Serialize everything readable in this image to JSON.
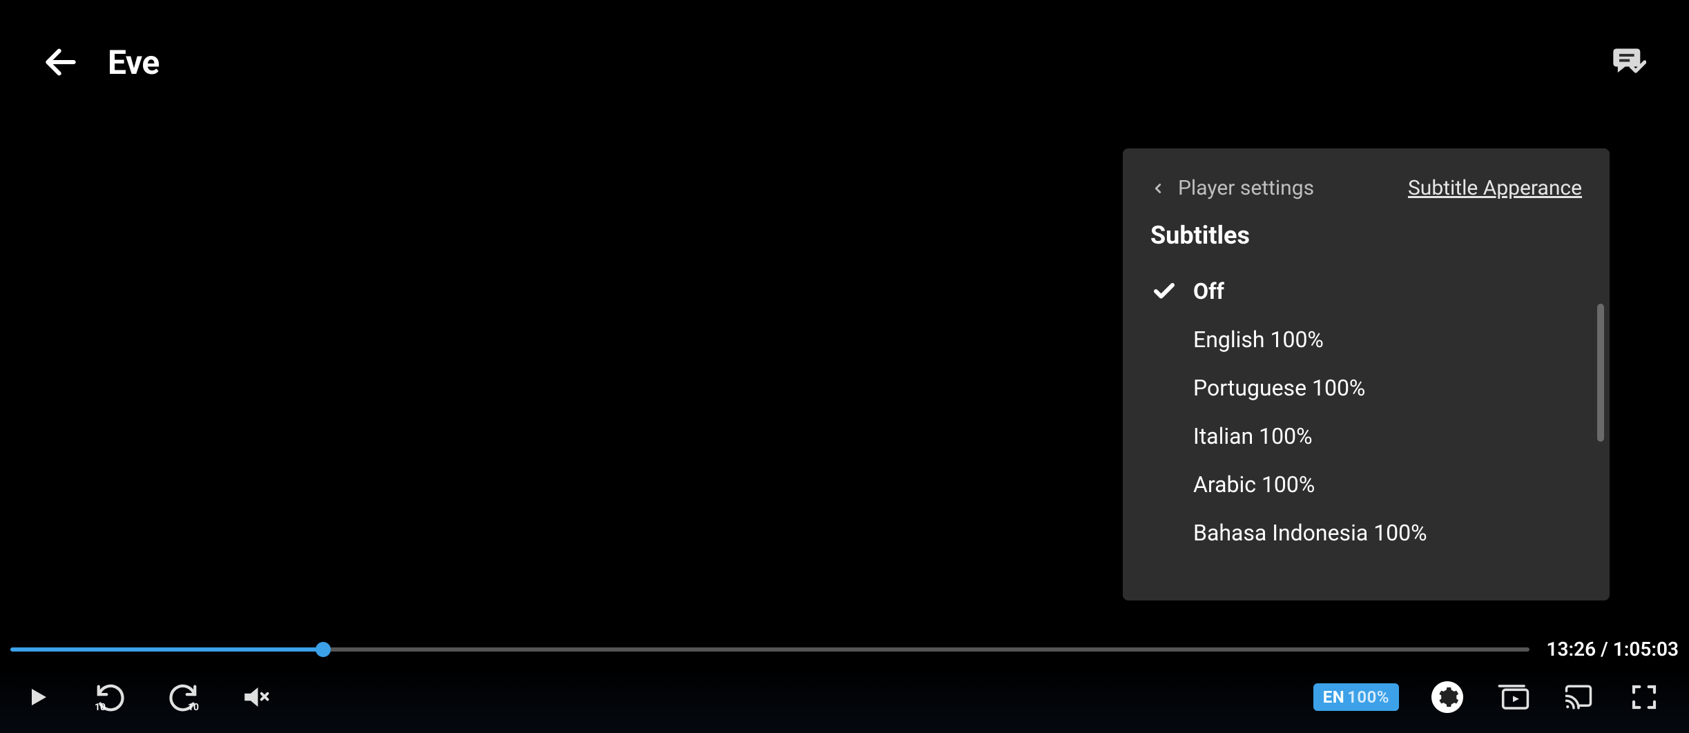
{
  "header": {
    "title": "Eve"
  },
  "popup": {
    "back_label": "Player settings",
    "appearance_link": "Subtitle Apperance",
    "section_title": "Subtitles",
    "options": [
      {
        "label": "Off",
        "selected": true
      },
      {
        "label": "English   100%",
        "selected": false
      },
      {
        "label": "Portuguese   100%",
        "selected": false
      },
      {
        "label": "Italian   100%",
        "selected": false
      },
      {
        "label": "Arabic   100%",
        "selected": false
      },
      {
        "label": "Bahasa Indonesia   100%",
        "selected": false
      }
    ]
  },
  "progress": {
    "current": "13:26",
    "total": "1:05:03",
    "percent": 20.6
  },
  "controls": {
    "cc_lang": "EN",
    "cc_percent": "100%",
    "seek_seconds": "10"
  },
  "colors": {
    "accent": "#3ca1e8",
    "panel": "#2e2e2e"
  }
}
